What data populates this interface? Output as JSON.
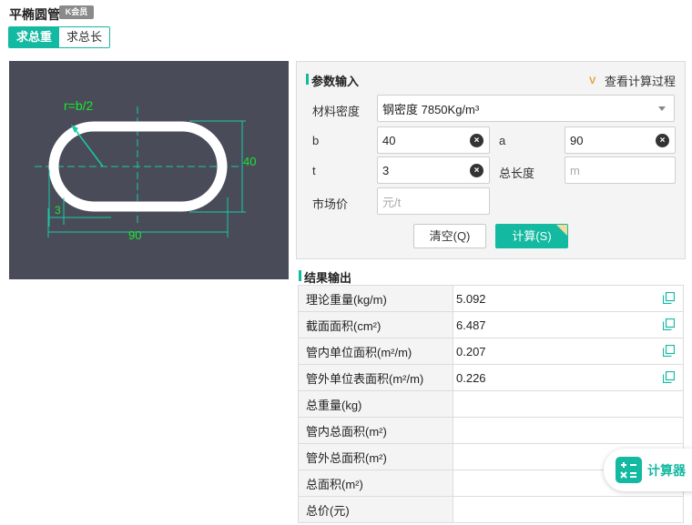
{
  "header": {
    "title": "平椭圆管",
    "vip_badge": "K会员"
  },
  "mode_tabs": [
    {
      "label": "求总重",
      "active": true
    },
    {
      "label": "求总长",
      "active": false
    }
  ],
  "diagram": {
    "radius_label": "r=b/2",
    "height_label": "40",
    "thickness_label": "3",
    "width_label": "90"
  },
  "params": {
    "section_title": "参数输入",
    "view_process": "查看计算过程",
    "material_label": "材料密度",
    "material_value": "钢密度 7850Kg/m³",
    "b_label": "b",
    "b_value": "40",
    "a_label": "a",
    "a_value": "90",
    "t_label": "t",
    "t_value": "3",
    "total_length_label": "总长度",
    "total_length_placeholder": "m",
    "market_price_label": "市场价",
    "market_price_placeholder": "元/t",
    "clear_button": "清空(Q)",
    "calc_button": "计算(S)"
  },
  "results": {
    "section_title": "结果输出",
    "rows": [
      {
        "name": "理论重量(kg/m)",
        "value": "5.092"
      },
      {
        "name": "截面面积(cm²)",
        "value": "6.487"
      },
      {
        "name": "管内单位面积(m²/m)",
        "value": "0.207"
      },
      {
        "name": "管外单位表面积(m²/m)",
        "value": "0.226"
      },
      {
        "name": "总重量(kg)",
        "value": ""
      },
      {
        "name": "管内总面积(m²)",
        "value": ""
      },
      {
        "name": "管外总面积(m²)",
        "value": ""
      },
      {
        "name": "总面积(m²)",
        "value": ""
      },
      {
        "name": "总价(元)",
        "value": ""
      }
    ]
  },
  "calculator_fab": {
    "label": "计算器"
  },
  "colors": {
    "accent": "#13b9a0",
    "diagram_bg": "#494c58",
    "dimension": "#19c8a8",
    "dim_text": "#19e830"
  }
}
